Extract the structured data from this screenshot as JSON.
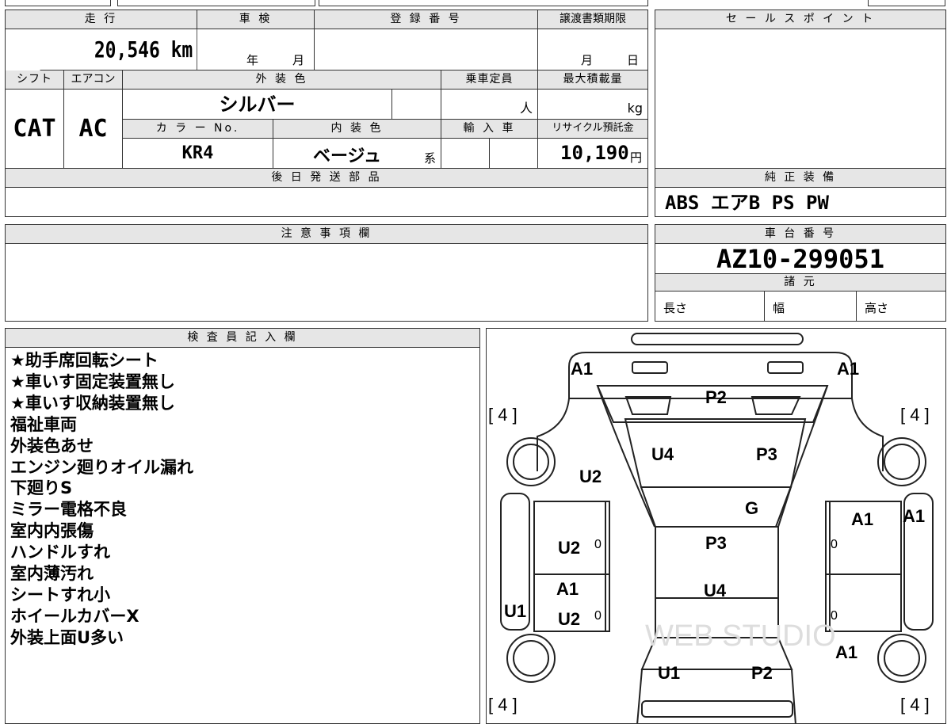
{
  "header_row": {
    "mileage_label": "走 行",
    "shaken_label": "車 検",
    "registration_label": "登 録 番 号",
    "deadline_label": "譲渡書類期限",
    "mileage_value": "20,546 km",
    "shaken_year": "年",
    "shaken_month": "月",
    "deadline_month": "月",
    "deadline_day": "日"
  },
  "spec_row": {
    "shift_label": "シフト",
    "ac_label": "エアコン",
    "exterior_label": "外 装 色",
    "capacity_label": "乗車定員",
    "max_load_label": "最大積載量",
    "shift_value": "CAT",
    "ac_value": "AC",
    "exterior_value": "シルバー",
    "capacity_unit": "人",
    "load_unit": "kg",
    "color_no_label": "カ ラ ー No.",
    "interior_label": "内 装 色",
    "import_label": "輸 入 車",
    "recycle_label": "リサイクル預託金",
    "color_no_value": "KR4",
    "interior_value": "ベージュ",
    "interior_suffix": "系",
    "recycle_value": "10,190",
    "recycle_unit": "円"
  },
  "later_parts_label": "後 日 発 送 部 品",
  "notes_label": "注 意 事 項 欄",
  "sales_point_label": "セ ー ル ス ポ イ ン ト",
  "genuine_equipment_label": "純 正 装 備",
  "genuine_equipment_value": "ABS エアB PS PW",
  "chassis_label": "車 台 番 号",
  "chassis_value": "AZ10-299051",
  "dimensions_label": "諸 元",
  "length_label": "長さ",
  "width_label": "幅",
  "height_label": "高さ",
  "inspector_label": "検 査 員 記 入 欄",
  "inspector_notes": [
    "★助手席回転シート",
    "★車いす固定装置無し",
    "★車いす収納装置無し",
    "福祉車両",
    "外装色あせ",
    "エンジン廻りオイル漏れ",
    "下廻りS",
    "ミラー電格不良",
    "室内内張傷",
    "ハンドルすれ",
    "室内薄汚れ",
    "シートすれ小",
    "ホイールカバーX",
    "外装上面U多い"
  ],
  "diagram": {
    "tire_marks": [
      "[ 4 ]",
      "[ 4 ]",
      "[ 4 ]",
      "[ 4 ]"
    ],
    "marks": [
      "A1",
      "A1",
      "P2",
      "U4",
      "P3",
      "U2",
      "G",
      "A1",
      "A1",
      "U2",
      "P3",
      "A1",
      "U4",
      "U1",
      "U2",
      "A1",
      "U1",
      "P2"
    ],
    "zeros": [
      "0",
      "0",
      "0",
      "0"
    ],
    "watermark": "WEB STUDIO"
  },
  "colors": {
    "header_bg": "#e6e6e6",
    "border": "#333333"
  }
}
